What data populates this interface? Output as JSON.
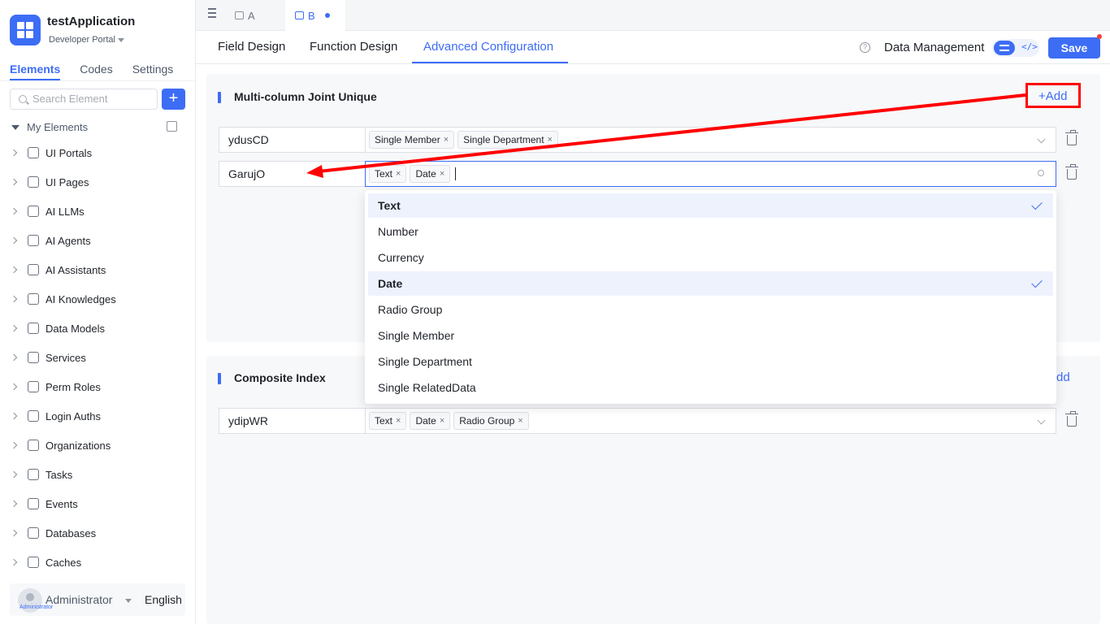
{
  "app": {
    "title": "testApplication",
    "portal": "Developer Portal"
  },
  "sidebar": {
    "tabs": [
      "Elements",
      "Codes",
      "Settings"
    ],
    "search_placeholder": "Search Element",
    "add_label": "+",
    "root_label": "My Elements",
    "items": [
      {
        "label": "UI Portals",
        "icon": "home-icon"
      },
      {
        "label": "UI Pages",
        "icon": "pages-icon"
      },
      {
        "label": "AI LLMs",
        "icon": "cube-icon"
      },
      {
        "label": "AI Agents",
        "icon": "robot-icon"
      },
      {
        "label": "AI Assistants",
        "icon": "ai-icon"
      },
      {
        "label": "AI Knowledges",
        "icon": "book-icon"
      },
      {
        "label": "Data Models",
        "icon": "table-icon"
      },
      {
        "label": "Services",
        "icon": "services-icon"
      },
      {
        "label": "Perm Roles",
        "icon": "roles-icon"
      },
      {
        "label": "Login Auths",
        "icon": "auth-icon"
      },
      {
        "label": "Organizations",
        "icon": "org-icon"
      },
      {
        "label": "Tasks",
        "icon": "tasks-icon"
      },
      {
        "label": "Events",
        "icon": "events-icon"
      },
      {
        "label": "Databases",
        "icon": "database-icon"
      },
      {
        "label": "Caches",
        "icon": "cache-icon"
      }
    ],
    "user": {
      "name": "Administrator",
      "avatar_caption": "Administrator",
      "language": "English"
    }
  },
  "tabs": [
    {
      "label": "A",
      "active": false
    },
    {
      "label": "B",
      "active": true,
      "modified": true
    }
  ],
  "subnav": {
    "tabs": [
      "Field Design",
      "Function Design",
      "Advanced Configuration"
    ],
    "active": "Advanced Configuration",
    "help": "?",
    "data_management": "Data Management",
    "code_toggle": "</>",
    "save": "Save"
  },
  "unique_section": {
    "title": "Multi-column Joint Unique",
    "add_label": "+Add",
    "rows": [
      {
        "name": "ydusCD",
        "tags": [
          "Single Member",
          "Single Department"
        ]
      },
      {
        "name": "GarujO",
        "tags": [
          "Text",
          "Date"
        ]
      }
    ]
  },
  "index_section": {
    "title": "Composite Index",
    "add_label": "dd",
    "rows": [
      {
        "name": "ydipWR",
        "tags": [
          "Text",
          "Date",
          "Radio Group"
        ]
      }
    ]
  },
  "dropdown": {
    "options": [
      {
        "label": "Text",
        "selected": true
      },
      {
        "label": "Number",
        "selected": false
      },
      {
        "label": "Currency",
        "selected": false
      },
      {
        "label": "Date",
        "selected": true
      },
      {
        "label": "Radio Group",
        "selected": false
      },
      {
        "label": "Single Member",
        "selected": false
      },
      {
        "label": "Single Department",
        "selected": false
      },
      {
        "label": "Single RelatedData",
        "selected": false
      }
    ]
  },
  "colors": {
    "accent": "#3d6df5",
    "annotation": "#ff0000"
  },
  "tag_remove": "×"
}
